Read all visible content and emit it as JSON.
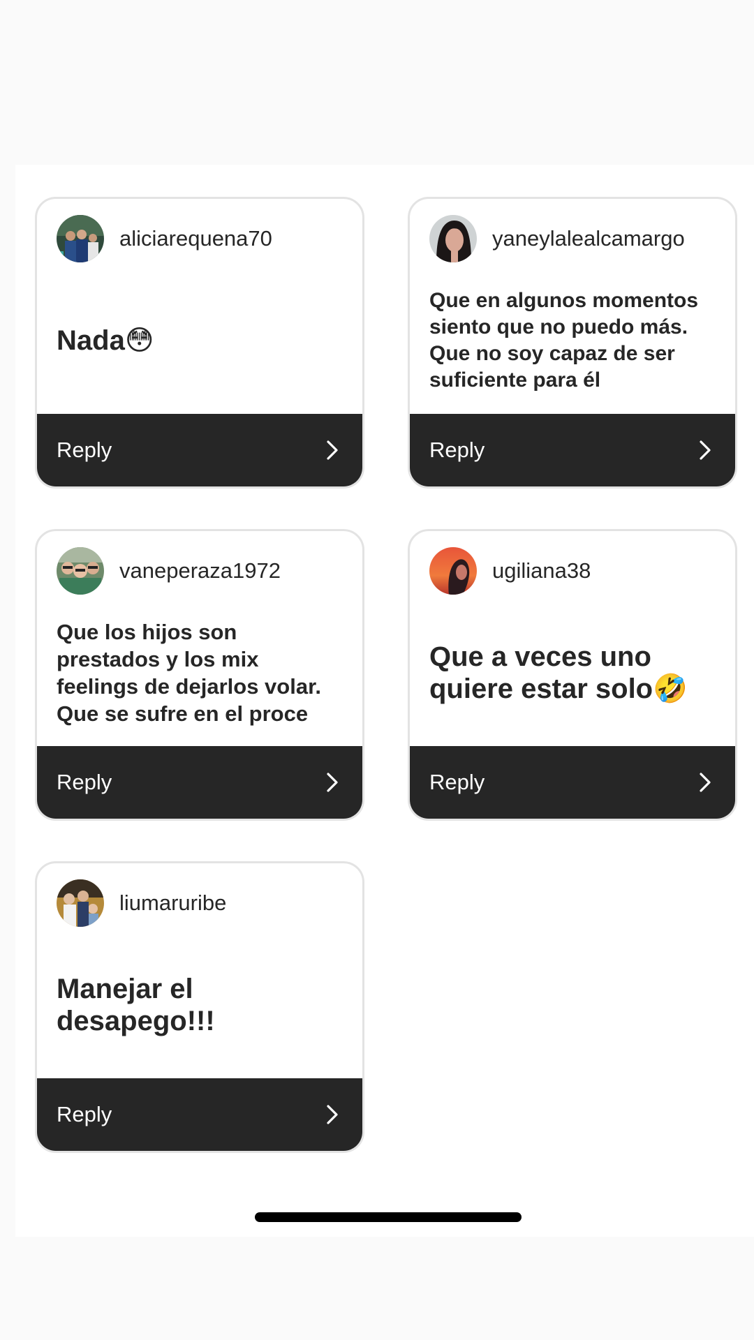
{
  "reply_label": "Reply",
  "colors": {
    "page_bg": "#fafafa",
    "card_bg": "#ffffff",
    "card_border": "#e3e3e3",
    "reply_bar": "#262626",
    "text": "#262626",
    "home_indicator": "#000000"
  },
  "cards": [
    {
      "username": "aliciarequena70",
      "message": "Nada😳",
      "avatar_icon": "profile-photo-group"
    },
    {
      "username": "yaneylalealcamargo",
      "message": "Que en algunos momentos siento que no puedo más. Que no soy capaz de ser suficiente para él",
      "avatar_icon": "profile-photo-woman"
    },
    {
      "username": "vaneperaza1972",
      "message": "Que los hijos son prestados y los mix feelings de dejarlos volar. Que se sufre en el proce",
      "avatar_icon": "profile-photo-selfie"
    },
    {
      "username": "ugiliana38",
      "message": "Que a veces uno quiere estar solo🤣",
      "avatar_icon": "profile-photo-sunset"
    },
    {
      "username": "liumaruribe",
      "message": "Manejar el desapego!!!",
      "avatar_icon": "profile-photo-family"
    }
  ]
}
